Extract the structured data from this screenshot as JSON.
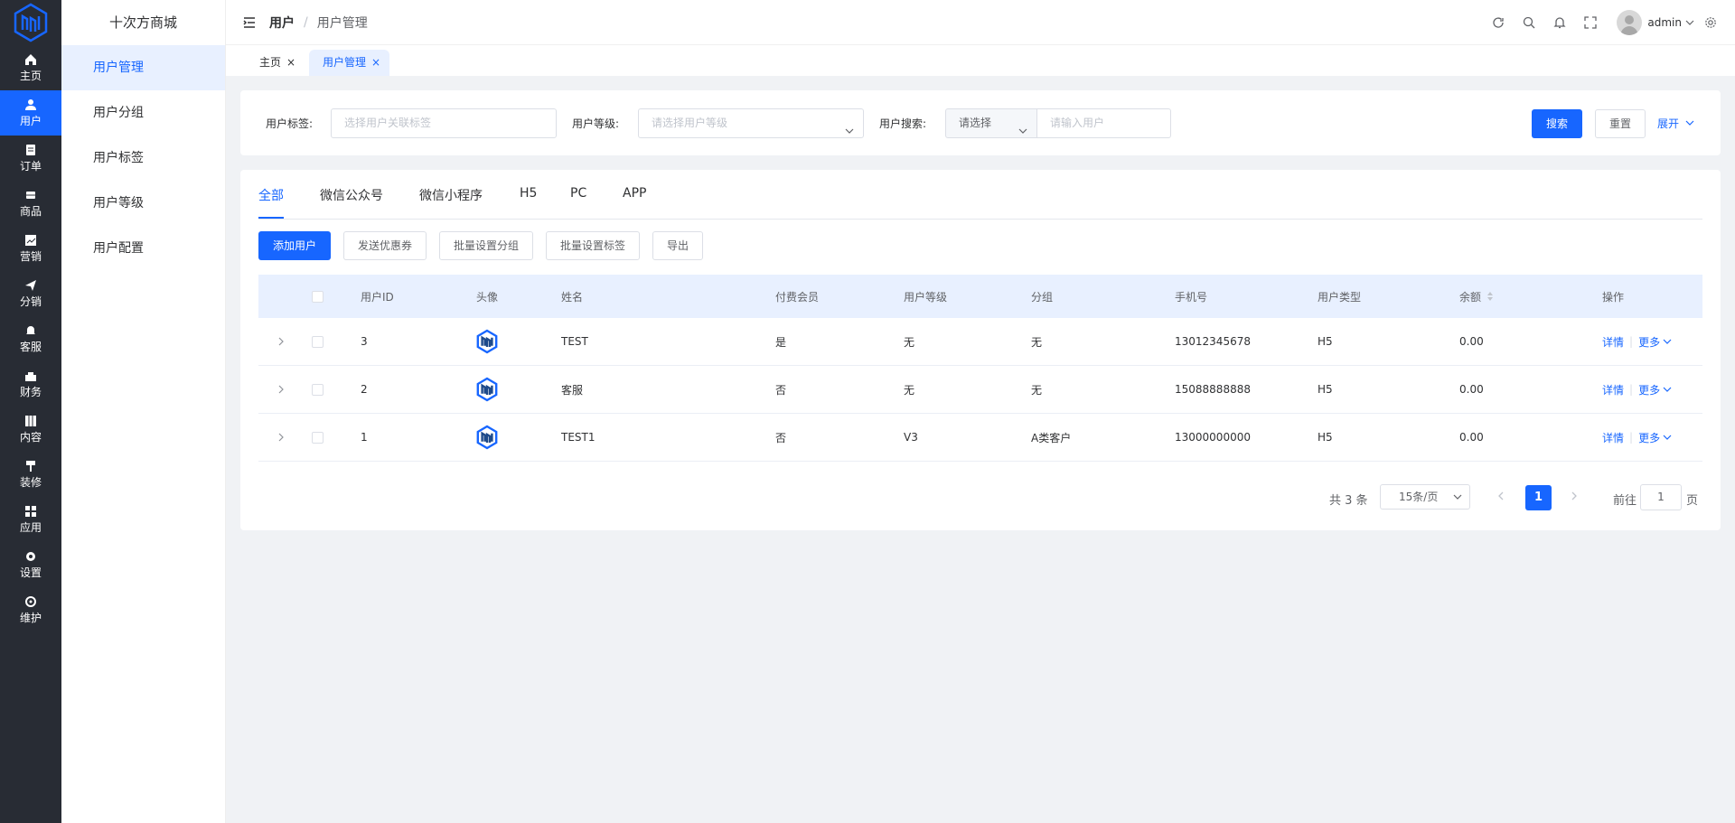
{
  "rail": {
    "items": [
      {
        "label": "主页",
        "icon": "home-icon"
      },
      {
        "label": "用户",
        "icon": "user-icon",
        "active": true
      },
      {
        "label": "订单",
        "icon": "order-icon"
      },
      {
        "label": "商品",
        "icon": "goods-icon"
      },
      {
        "label": "营销",
        "icon": "marketing-icon"
      },
      {
        "label": "分销",
        "icon": "distribution-icon"
      },
      {
        "label": "客服",
        "icon": "service-icon"
      },
      {
        "label": "财务",
        "icon": "finance-icon"
      },
      {
        "label": "内容",
        "icon": "content-icon"
      },
      {
        "label": "装修",
        "icon": "decorate-icon"
      },
      {
        "label": "应用",
        "icon": "apps-icon"
      },
      {
        "label": "设置",
        "icon": "settings-icon"
      },
      {
        "label": "维护",
        "icon": "maintenance-icon"
      }
    ]
  },
  "submenu": {
    "title": "十次方商城",
    "items": [
      "用户管理",
      "用户分组",
      "用户标签",
      "用户等级",
      "用户配置"
    ]
  },
  "header": {
    "crumb_root": "用户",
    "crumb_sep": "/",
    "crumb_current": "用户管理",
    "username": "admin"
  },
  "tags": [
    {
      "label": "主页",
      "close": "×"
    },
    {
      "label": "用户管理",
      "close": "×"
    }
  ],
  "filter": {
    "tag_label": "用户标签:",
    "tag_placeholder": "选择用户关联标签",
    "level_label": "用户等级:",
    "level_placeholder": "请选择用户等级",
    "search_label": "用户搜索:",
    "search_select": "请选择",
    "search_placeholder": "请输入用户",
    "search_button": "搜索",
    "reset_button": "重置",
    "expand": "展开"
  },
  "tabs": [
    "全部",
    "微信公众号",
    "微信小程序",
    "H5",
    "PC",
    "APP"
  ],
  "toolbar": {
    "add": "添加用户",
    "coupon": "发送优惠券",
    "batch_group": "批量设置分组",
    "batch_tag": "批量设置标签",
    "export": "导出"
  },
  "table": {
    "columns": [
      "用户ID",
      "头像",
      "姓名",
      "付费会员",
      "用户等级",
      "分组",
      "手机号",
      "用户类型",
      "余额",
      "操作"
    ],
    "rows": [
      {
        "id": "3",
        "name": "TEST",
        "paid": "是",
        "level": "无",
        "group": "无",
        "phone": "13012345678",
        "type": "H5",
        "balance": "0.00"
      },
      {
        "id": "2",
        "name": "客服",
        "paid": "否",
        "level": "无",
        "group": "无",
        "phone": "15088888888",
        "type": "H5",
        "balance": "0.00"
      },
      {
        "id": "1",
        "name": "TEST1",
        "paid": "否",
        "level": "V3",
        "group": "A类客户",
        "phone": "13000000000",
        "type": "H5",
        "balance": "0.00"
      }
    ],
    "detail": "详情",
    "more": "更多"
  },
  "pager": {
    "total": "共 3 条",
    "size": "15条/页",
    "current": "1",
    "goto": "前往",
    "jump_value": "1",
    "page_suffix": "页"
  },
  "colors": {
    "primary": "#1766ff",
    "rail": "#282c34",
    "active_bg": "#e8f0ff"
  }
}
